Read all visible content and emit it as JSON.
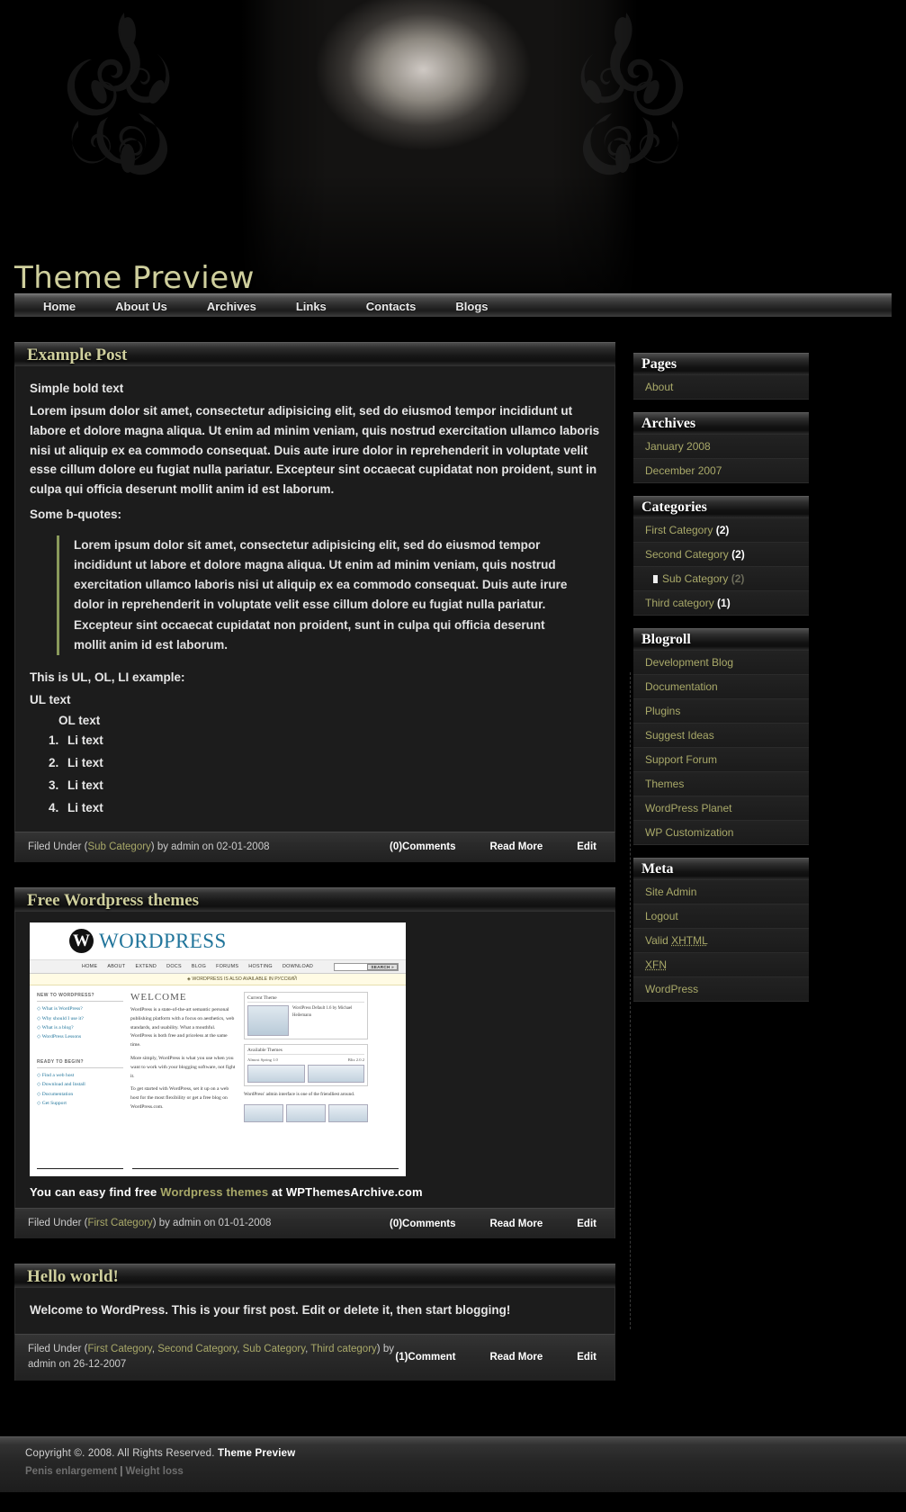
{
  "site": {
    "title": "Theme Preview",
    "nav": [
      {
        "label": "Home"
      },
      {
        "label": "About Us"
      },
      {
        "label": "Archives"
      },
      {
        "label": "Links"
      },
      {
        "label": "Contacts"
      },
      {
        "label": "Blogs"
      }
    ]
  },
  "colors": {
    "accent": "#a9a969",
    "title_accent": "#cfcf9d",
    "body_bg": "#000000",
    "post_bg": "#1c1c1c",
    "quote_border": "#8a9a5b"
  },
  "posts": [
    {
      "title": "Example Post",
      "bold_line": "Simple bold text",
      "paragraph": "Lorem ipsum dolor sit amet, consectetur adipisicing elit, sed do eiusmod tempor incididunt ut labore et dolore magna aliqua. Ut enim ad minim veniam, quis nostrud exercitation ullamco laboris nisi ut aliquip ex ea commodo consequat. Duis aute irure dolor in reprehenderit in voluptate velit esse cillum dolore eu fugiat nulla pariatur. Excepteur sint occaecat cupidatat non proident, sunt in culpa qui officia deserunt mollit anim id est laborum.",
      "quote_intro": "Some b-quotes:",
      "blockquote": "Lorem ipsum dolor sit amet, consectetur adipisicing elit, sed do eiusmod tempor incididunt ut labore et dolore magna aliqua. Ut enim ad minim veniam, quis nostrud exercitation ullamco laboris nisi ut aliquip ex ea commodo consequat. Duis aute irure dolor in reprehenderit in voluptate velit esse cillum dolore eu fugiat nulla pariatur. Excepteur sint occaecat cupidatat non proident, sunt in culpa qui officia deserunt mollit anim id est laborum.",
      "list_intro": "This is UL, OL, LI example:",
      "ul_text": "UL text",
      "ol_text": "OL text",
      "li_items": [
        "Li text",
        "Li text",
        "Li text",
        "Li text"
      ],
      "meta": {
        "filed_under_prefix": "Filed Under (",
        "categories": [
          "Sub Category"
        ],
        "filed_under_suffix": ") by admin on 02-01-2008",
        "comments": "(0)Comments",
        "read_more": "Read More",
        "edit": "Edit"
      }
    },
    {
      "title": "Free Wordpress themes",
      "caption_before": "You can easy find free ",
      "caption_link": "Wordpress themes",
      "caption_after": " at WPThemesArchive.com",
      "meta": {
        "filed_under_prefix": "Filed Under (",
        "categories": [
          "First Category"
        ],
        "filed_under_suffix": ") by admin on 01-01-2008",
        "comments": "(0)Comments",
        "read_more": "Read More",
        "edit": "Edit"
      }
    },
    {
      "title": "Hello world!",
      "body": "Welcome to WordPress. This is your first post. Edit or delete it, then start blogging!",
      "meta": {
        "filed_under_prefix": "Filed Under (",
        "categories": [
          "First Category",
          "Second Category",
          "Sub Category",
          "Third category"
        ],
        "filed_under_suffix": ") by admin on 26-12-2007",
        "comments": "(1)Comment",
        "read_more": "Read More",
        "edit": "Edit"
      }
    }
  ],
  "wp_screenshot": {
    "logo_letter": "W",
    "logo_word": "WORDPRESS",
    "nav": [
      "HOME",
      "ABOUT",
      "EXTEND",
      "DOCS",
      "BLOG",
      "FORUMS",
      "HOSTING",
      "DOWNLOAD"
    ],
    "search_button": "SEARCH »",
    "notice": "◈ WORDPRESS IS ALSO AVAILABLE IN РУССКИЙ",
    "left_head_1": "NEW TO WORDPRESS?",
    "left_links_1": [
      "◇ What is WordPress?",
      "◇ Why should I use it?",
      "◇ What is a blog?",
      "◇ WordPress Lessons"
    ],
    "left_head_2": "READY TO BEGIN?",
    "left_links_2": [
      "◇ Find a web host",
      "◇ Download and Install",
      "◇ Documentation",
      "◇ Get Support"
    ],
    "welcome_title": "WELCOME",
    "welcome_p1": "WordPress is a state-of-the-art semantic personal publishing platform with a focus on aesthetics, web standards, and usability. What a mouthful. WordPress is both free and priceless at the same time.",
    "welcome_p2": "More simply, WordPress is what you use when you want to work with your blogging software, not fight it.",
    "welcome_p3": "To get started with WordPress, set it up on a web host for the most flexibility or get a free blog on WordPress.com.",
    "panel_1_title": "Current Theme",
    "panel_1_text": "WordPress Default 1.6 by Michael Heilemann",
    "panel_2_title": "Available Themes",
    "panel_2_label_a": "Almost Spring 1.0",
    "panel_2_label_b": "Blix 2.0.2",
    "caption": "WordPress' admin interface is one of the friendliest around."
  },
  "sidebar": {
    "widgets": [
      {
        "title": "Pages",
        "items": [
          {
            "label": "About"
          }
        ]
      },
      {
        "title": "Archives",
        "items": [
          {
            "label": "January 2008"
          },
          {
            "label": "December 2007"
          }
        ]
      },
      {
        "title": "Categories",
        "items": [
          {
            "label": "First Category",
            "count": "(2)"
          },
          {
            "label": "Second Category",
            "count": "(2)"
          },
          {
            "label": "Sub Category",
            "count": "(2)",
            "sub": true,
            "dim_count": true
          },
          {
            "label": "Third category",
            "count": "(1)"
          }
        ]
      },
      {
        "title": "Blogroll",
        "items": [
          {
            "label": "Development Blog"
          },
          {
            "label": "Documentation"
          },
          {
            "label": "Plugins"
          },
          {
            "label": "Suggest Ideas"
          },
          {
            "label": "Support Forum"
          },
          {
            "label": "Themes"
          },
          {
            "label": "WordPress Planet"
          },
          {
            "label": "WP Customization"
          }
        ]
      },
      {
        "title": "Meta",
        "items": [
          {
            "label": "Site Admin"
          },
          {
            "label": "Logout"
          },
          {
            "label": "Valid XHTML",
            "abbr_from": 6
          },
          {
            "label": "XFN",
            "abbr_from": 0
          },
          {
            "label": "WordPress"
          }
        ]
      }
    ]
  },
  "footer": {
    "copyright_text": "Copyright ©. 2008. All Rights Reserved. ",
    "copyright_name": "Theme Preview",
    "links": [
      {
        "label": "Penis enlargement"
      },
      {
        "label": "Weight loss"
      }
    ],
    "separator": "|"
  }
}
